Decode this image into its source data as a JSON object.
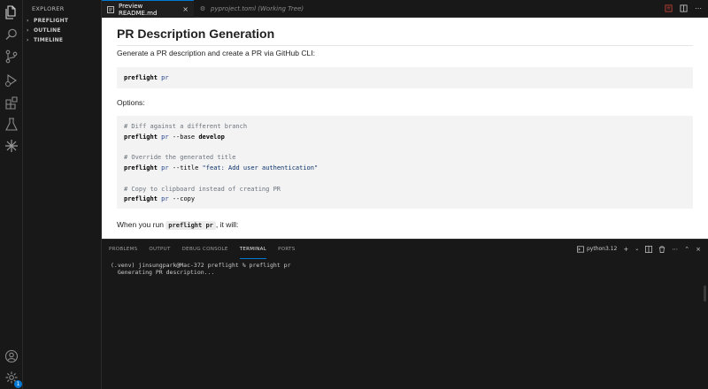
{
  "sidebar": {
    "title": "EXPLORER",
    "sections": [
      {
        "label": "PREFLIGHT"
      },
      {
        "label": "OUTLINE"
      },
      {
        "label": "TIMELINE"
      }
    ]
  },
  "activity": {
    "items": [
      "files-icon",
      "search-icon",
      "source-control-icon",
      "run-debug-icon",
      "extensions-icon",
      "testing-icon",
      "ai-sparkle-icon"
    ],
    "bottom": [
      "account-icon",
      "manage-gear-icon"
    ],
    "badge": "1"
  },
  "tabs": [
    {
      "label": "Preview README.md",
      "active": true
    },
    {
      "label": "pyproject.toml (Working Tree)",
      "active": false
    }
  ],
  "preview": {
    "heading": "PR Description Generation",
    "intro": "Generate a PR description and create a PR via GitHub CLI:",
    "code1": {
      "cmd": "preflight",
      "arg": "pr"
    },
    "options_label": "Options:",
    "code2": {
      "c1": "# Diff against a different branch",
      "l1_cmd": "preflight",
      "l1_arg": "pr",
      "l1_flag": "--base",
      "l1_val": "develop",
      "c2": "# Override the generated title",
      "l2_cmd": "preflight",
      "l2_arg": "pr",
      "l2_flag": "--title",
      "l2_val": "\"feat: Add user authentication\"",
      "c3": "# Copy to clipboard instead of creating PR",
      "l3_cmd": "preflight",
      "l3_arg": "pr",
      "l3_flag": "--copy"
    },
    "run_prefix": "When you run",
    "run_code": "preflight pr",
    "run_suffix": ", it will:"
  },
  "panel": {
    "tabs": [
      "PROBLEMS",
      "OUTPUT",
      "DEBUG CONSOLE",
      "TERMINAL",
      "PORTS"
    ],
    "active_tab": "TERMINAL",
    "terminal_name": "python3.12",
    "lines": [
      "(.venv) jinsungpark@Mac-372 preflight % preflight pr",
      "  Generating PR description..."
    ]
  },
  "colors": {
    "accent": "#0078d4",
    "background": "#181818",
    "preview_bg": "#ffffff"
  }
}
